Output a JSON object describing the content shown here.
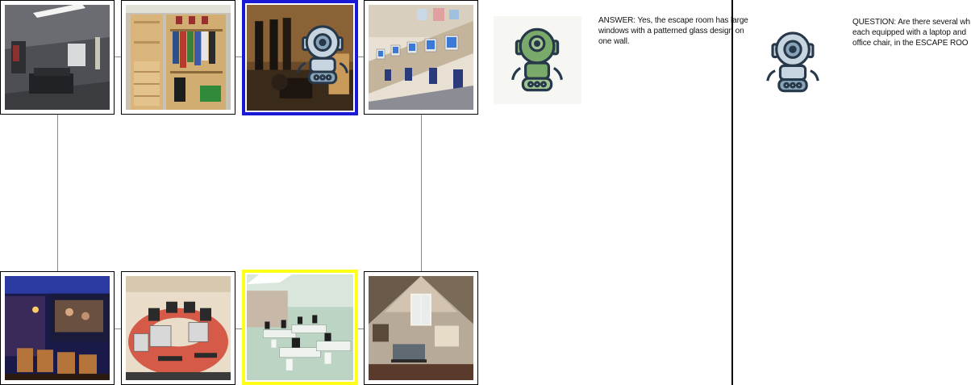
{
  "grid": {
    "tiles": [
      {
        "id": "home-theater-room",
        "state": "normal"
      },
      {
        "id": "closet-room",
        "state": "normal"
      },
      {
        "id": "escape-room",
        "state": "current-blue"
      },
      {
        "id": "computer-lab-row",
        "state": "normal"
      },
      {
        "id": "home-cinema",
        "state": "normal"
      },
      {
        "id": "round-computer-table",
        "state": "normal"
      },
      {
        "id": "white-computer-lab",
        "state": "target-yellow"
      },
      {
        "id": "attic-living-room",
        "state": "normal"
      }
    ],
    "highlight_colors": {
      "current": "#1a1ad6",
      "target": "#ffff1a"
    }
  },
  "chat": {
    "answer_text": "ANSWER: Yes, the escape room has large windows with a patterned glass design on one wall.",
    "question_text": "QUESTION: Are there several wh each equipped with a laptop and office chair, in the ESCAPE ROO",
    "answer_avatar_icon": "green-robot-icon",
    "question_avatar_icon": "blue-robot-icon"
  }
}
